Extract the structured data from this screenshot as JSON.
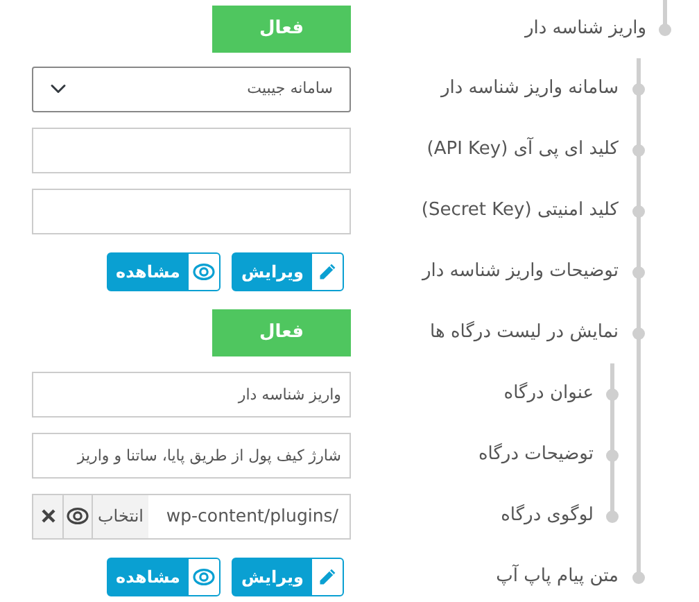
{
  "settings": {
    "label": "واریز شناسه دار",
    "control": {
      "kind": "toggle",
      "label": "فعال",
      "on": true
    },
    "children": [
      {
        "label": "سامانه واریز شناسه دار",
        "control": {
          "kind": "select",
          "value": "سامانه جیبیت"
        }
      },
      {
        "label": "کلید ای پی آی (API Key)",
        "control": {
          "kind": "input"
        }
      },
      {
        "label": "کلید امنیتی (Secret Key)",
        "control": {
          "kind": "input"
        }
      },
      {
        "label": "توضیحات واریز شناسه دار",
        "control": {
          "kind": "editor",
          "edit_label": "ویرایش",
          "view_label": "مشاهده"
        }
      },
      {
        "label": "نمایش در لیست درگاه ها",
        "control": {
          "kind": "toggle",
          "label": "فعال",
          "on": true
        },
        "children": [
          {
            "label": "عنوان درگاه",
            "control": {
              "kind": "input",
              "value": "واریز شناسه دار"
            }
          },
          {
            "label": "توضیحات درگاه",
            "control": {
              "kind": "input",
              "value": "شارژ کیف پول از طریق پایا، ساتنا و واریز"
            }
          },
          {
            "label": "لوگوی درگاه",
            "control": {
              "kind": "media",
              "value": "wp-content/plugins/",
              "choose_label": "انتخاب"
            }
          }
        ]
      },
      {
        "label": "متن پیام پاپ آپ",
        "control": {
          "kind": "editor",
          "edit_label": "ویرایش",
          "view_label": "مشاهده"
        }
      }
    ]
  }
}
